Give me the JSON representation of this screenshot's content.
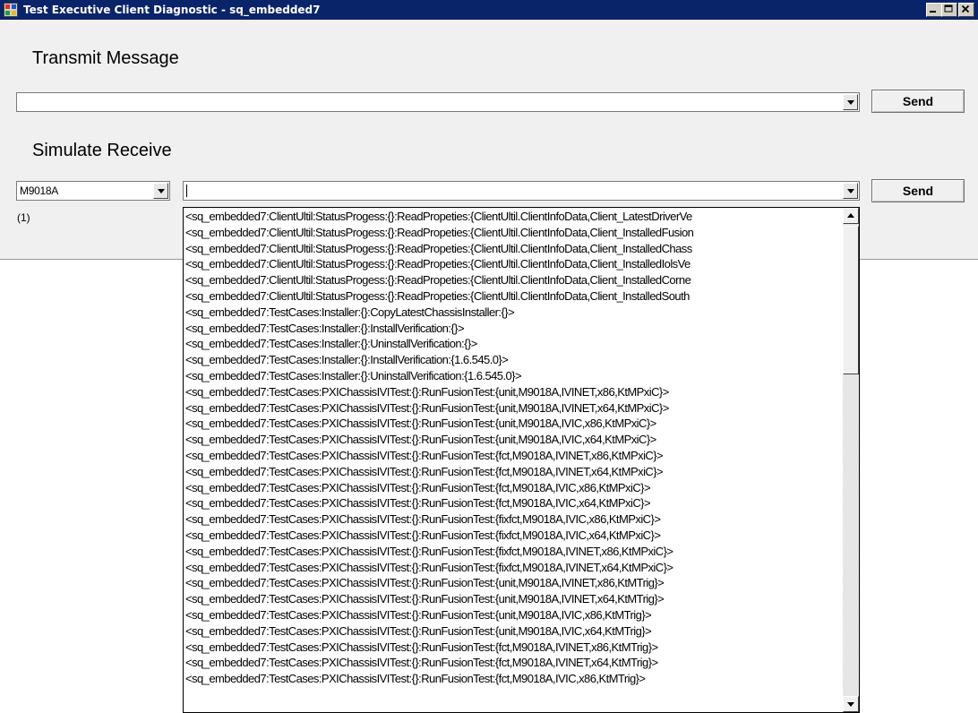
{
  "window": {
    "title": "Test Executive Client Diagnostic - sq_embedded7"
  },
  "transmit": {
    "section_label": "Transmit Message",
    "message_value": "",
    "send_label": "Send"
  },
  "receive": {
    "section_label": "Simulate Receive",
    "device_value": "M9018A",
    "message_value": "",
    "send_label": "Send",
    "count_label": "(1)"
  },
  "dropdown": {
    "items": [
      "<sq_embedded7:ClientUltil:StatusProgess:{}:ReadPropeties:{ClientUltil.ClientInfoData,Client_LatestDriverVe",
      "<sq_embedded7:ClientUltil:StatusProgess:{}:ReadPropeties:{ClientUltil.ClientInfoData,Client_InstalledFusion",
      "<sq_embedded7:ClientUltil:StatusProgess:{}:ReadPropeties:{ClientUltil.ClientInfoData,Client_InstalledChass",
      "<sq_embedded7:ClientUltil:StatusProgess:{}:ReadPropeties:{ClientUltil.ClientInfoData,Client_InstalledIolsVe",
      "<sq_embedded7:ClientUltil:StatusProgess:{}:ReadPropeties:{ClientUltil.ClientInfoData,Client_InstalledCorne",
      "<sq_embedded7:ClientUltil:StatusProgess:{}:ReadPropeties:{ClientUltil.ClientInfoData,Client_InstalledSouth",
      "<sq_embedded7:TestCases:Installer:{}:CopyLatestChassisInstaller:{}>",
      "<sq_embedded7:TestCases:Installer:{}:InstallVerification:{}>",
      "<sq_embedded7:TestCases:Installer:{}:UninstallVerification:{}>",
      "<sq_embedded7:TestCases:Installer:{}:InstallVerification:{1.6.545.0}>",
      "<sq_embedded7:TestCases:Installer:{}:UninstallVerification:{1.6.545.0}>",
      "<sq_embedded7:TestCases:PXIChassisIVITest:{}:RunFusionTest:{unit,M9018A,IVINET,x86,KtMPxiC}>",
      "<sq_embedded7:TestCases:PXIChassisIVITest:{}:RunFusionTest:{unit,M9018A,IVINET,x64,KtMPxiC}>",
      "<sq_embedded7:TestCases:PXIChassisIVITest:{}:RunFusionTest:{unit,M9018A,IVIC,x86,KtMPxiC}>",
      "<sq_embedded7:TestCases:PXIChassisIVITest:{}:RunFusionTest:{unit,M9018A,IVIC,x64,KtMPxiC}>",
      "<sq_embedded7:TestCases:PXIChassisIVITest:{}:RunFusionTest:{fct,M9018A,IVINET,x86,KtMPxiC}>",
      "<sq_embedded7:TestCases:PXIChassisIVITest:{}:RunFusionTest:{fct,M9018A,IVINET,x64,KtMPxiC}>",
      "<sq_embedded7:TestCases:PXIChassisIVITest:{}:RunFusionTest:{fct,M9018A,IVIC,x86,KtMPxiC}>",
      "<sq_embedded7:TestCases:PXIChassisIVITest:{}:RunFusionTest:{fct,M9018A,IVIC,x64,KtMPxiC}>",
      "<sq_embedded7:TestCases:PXIChassisIVITest:{}:RunFusionTest:{fixfct,M9018A,IVIC,x86,KtMPxiC}>",
      "<sq_embedded7:TestCases:PXIChassisIVITest:{}:RunFusionTest:{fixfct,M9018A,IVIC,x64,KtMPxiC}>",
      "<sq_embedded7:TestCases:PXIChassisIVITest:{}:RunFusionTest:{fixfct,M9018A,IVINET,x86,KtMPxiC}>",
      "<sq_embedded7:TestCases:PXIChassisIVITest:{}:RunFusionTest:{fixfct,M9018A,IVINET,x64,KtMPxiC}>",
      "<sq_embedded7:TestCases:PXIChassisIVITest:{}:RunFusionTest:{unit,M9018A,IVINET,x86,KtMTrig}>",
      "<sq_embedded7:TestCases:PXIChassisIVITest:{}:RunFusionTest:{unit,M9018A,IVINET,x64,KtMTrig}>",
      "<sq_embedded7:TestCases:PXIChassisIVITest:{}:RunFusionTest:{unit,M9018A,IVIC,x86,KtMTrig}>",
      "<sq_embedded7:TestCases:PXIChassisIVITest:{}:RunFusionTest:{unit,M9018A,IVIC,x64,KtMTrig}>",
      "<sq_embedded7:TestCases:PXIChassisIVITest:{}:RunFusionTest:{fct,M9018A,IVINET,x86,KtMTrig}>",
      "<sq_embedded7:TestCases:PXIChassisIVITest:{}:RunFusionTest:{fct,M9018A,IVINET,x64,KtMTrig}>",
      "<sq_embedded7:TestCases:PXIChassisIVITest:{}:RunFusionTest:{fct,M9018A,IVIC,x86,KtMTrig}>"
    ]
  },
  "icons": {
    "app": "app-window-icon",
    "minimize": "minimize-icon",
    "maximize": "maximize-icon",
    "close": "close-icon",
    "dropdown": "chevron-down-icon",
    "scroll_up": "scroll-up-icon",
    "scroll_down": "scroll-down-icon"
  },
  "colors": {
    "titlebar": "#0a246a",
    "window_bg": "#f0f0f0",
    "list_bg": "#ffffff"
  }
}
